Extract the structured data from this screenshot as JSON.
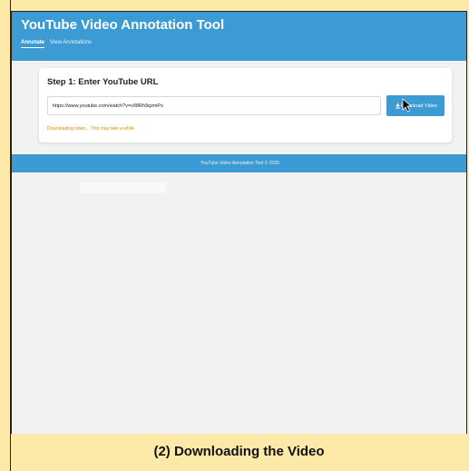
{
  "app": {
    "title": "YouTube Video Annotation Tool",
    "nav": [
      {
        "label": "Annotate",
        "active": true
      },
      {
        "label": "View Annotations",
        "active": false
      }
    ]
  },
  "step1": {
    "heading": "Step 1: Enter YouTube URL",
    "url_value": "https://www.youtube.com/watch?v=v98Rh9qzmPs",
    "download_button": {
      "label": "Download Video",
      "icon": "download-icon"
    },
    "status": "Downloading video... This may take a while."
  },
  "footer": {
    "text": "YouTube Video Annotation Tool © 2025"
  },
  "caption": "(2) Downloading the Video",
  "colors": {
    "accent": "#3d9bd4",
    "status": "#d98c0a",
    "caption_bg": "#fde9a8"
  }
}
